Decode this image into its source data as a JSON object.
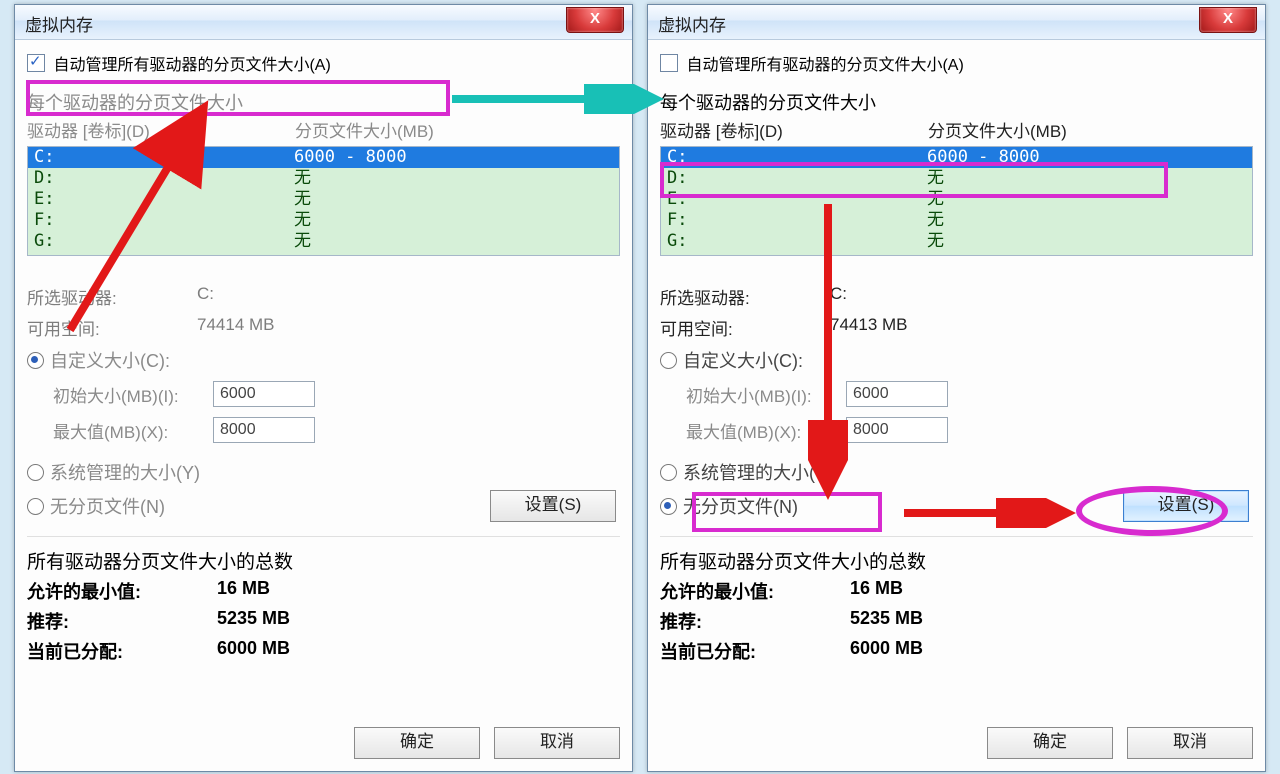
{
  "left": {
    "title": "虚拟内存",
    "close_glyph": "X",
    "auto_manage_checked": true,
    "auto_manage_label": "自动管理所有驱动器的分页文件大小(A)",
    "per_drive_label": "每个驱动器的分页文件大小",
    "header_drive": "驱动器 [卷标](D)",
    "header_page": "分页文件大小(MB)",
    "drives": [
      {
        "name": "C:",
        "value": "6000 - 8000",
        "selected": true
      },
      {
        "name": "D:",
        "value": "无",
        "selected": false
      },
      {
        "name": "E:",
        "value": "无",
        "selected": false
      },
      {
        "name": "F:",
        "value": "无",
        "selected": false
      },
      {
        "name": "G:",
        "value": "无",
        "selected": false
      }
    ],
    "selected_drive_label": "所选驱动器:",
    "selected_drive_value": "C:",
    "free_space_label": "可用空间:",
    "free_space_value": "74414 MB",
    "custom_label": "自定义大小(C):",
    "custom_selected": true,
    "init_label": "初始大小(MB)(I):",
    "init_value": "6000",
    "max_label": "最大值(MB)(X):",
    "max_value": "8000",
    "system_label": "系统管理的大小(Y)",
    "none_label": "无分页文件(N)",
    "none_selected": false,
    "set_button": "设置(S)",
    "totals_title": "所有驱动器分页文件大小的总数",
    "min_allowed_label": "允许的最小值:",
    "min_allowed_value": "16 MB",
    "recommend_label": "推荐:",
    "recommend_value": "5235 MB",
    "current_label": "当前已分配:",
    "current_value": "6000 MB",
    "ok": "确定",
    "cancel": "取消"
  },
  "right": {
    "title": "虚拟内存",
    "close_glyph": "X",
    "auto_manage_checked": false,
    "auto_manage_label": "自动管理所有驱动器的分页文件大小(A)",
    "per_drive_label": "每个驱动器的分页文件大小",
    "header_drive": "驱动器 [卷标](D)",
    "header_page": "分页文件大小(MB)",
    "drives": [
      {
        "name": "C:",
        "value": "6000 - 8000",
        "selected": true
      },
      {
        "name": "D:",
        "value": "无",
        "selected": false
      },
      {
        "name": "E:",
        "value": "无",
        "selected": false
      },
      {
        "name": "F:",
        "value": "无",
        "selected": false
      },
      {
        "name": "G:",
        "value": "无",
        "selected": false
      }
    ],
    "selected_drive_label": "所选驱动器:",
    "selected_drive_value": "C:",
    "free_space_label": "可用空间:",
    "free_space_value": "74413 MB",
    "custom_label": "自定义大小(C):",
    "custom_selected": false,
    "init_label": "初始大小(MB)(I):",
    "init_value": "6000",
    "max_label": "最大值(MB)(X):",
    "max_value": "8000",
    "system_label": "系统管理的大小(Y)",
    "none_label": "无分页文件(N)",
    "none_selected": true,
    "set_button": "设置(S)",
    "totals_title": "所有驱动器分页文件大小的总数",
    "min_allowed_label": "允许的最小值:",
    "min_allowed_value": "16 MB",
    "recommend_label": "推荐:",
    "recommend_value": "5235 MB",
    "current_label": "当前已分配:",
    "current_value": "6000 MB",
    "ok": "确定",
    "cancel": "取消"
  }
}
